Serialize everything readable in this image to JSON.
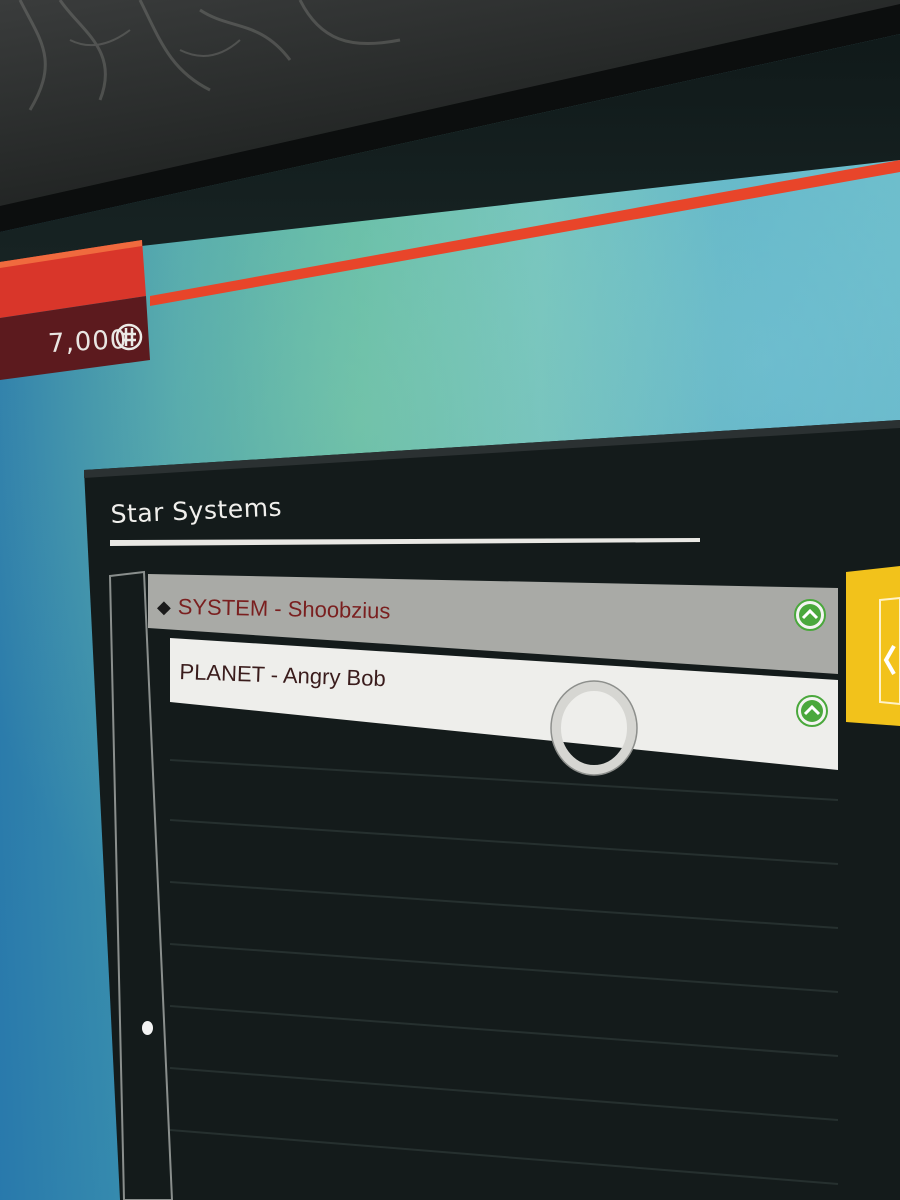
{
  "hud": {
    "units_value": "7,000",
    "units_icon": "units-currency-icon",
    "accent_color": "#e8452a"
  },
  "star_systems_menu": {
    "title": "Star Systems",
    "items": [
      {
        "label": "SYSTEM - Shoobzius",
        "marker_icon": "diamond-icon",
        "action_icon": "chevron-up-icon",
        "selected": true
      },
      {
        "label": "PLANET - Angry Bob",
        "action_icon": "chevron-up-icon",
        "selected": false
      }
    ],
    "colors": {
      "system_row": "#a9aaa6",
      "planet_row": "#eeeeeb",
      "system_text": "#7a1f1f",
      "chevron_green": "#4aa83c",
      "side_panel": "#f2c21b"
    }
  },
  "cursor": {
    "icon": "selection-ring-icon"
  }
}
